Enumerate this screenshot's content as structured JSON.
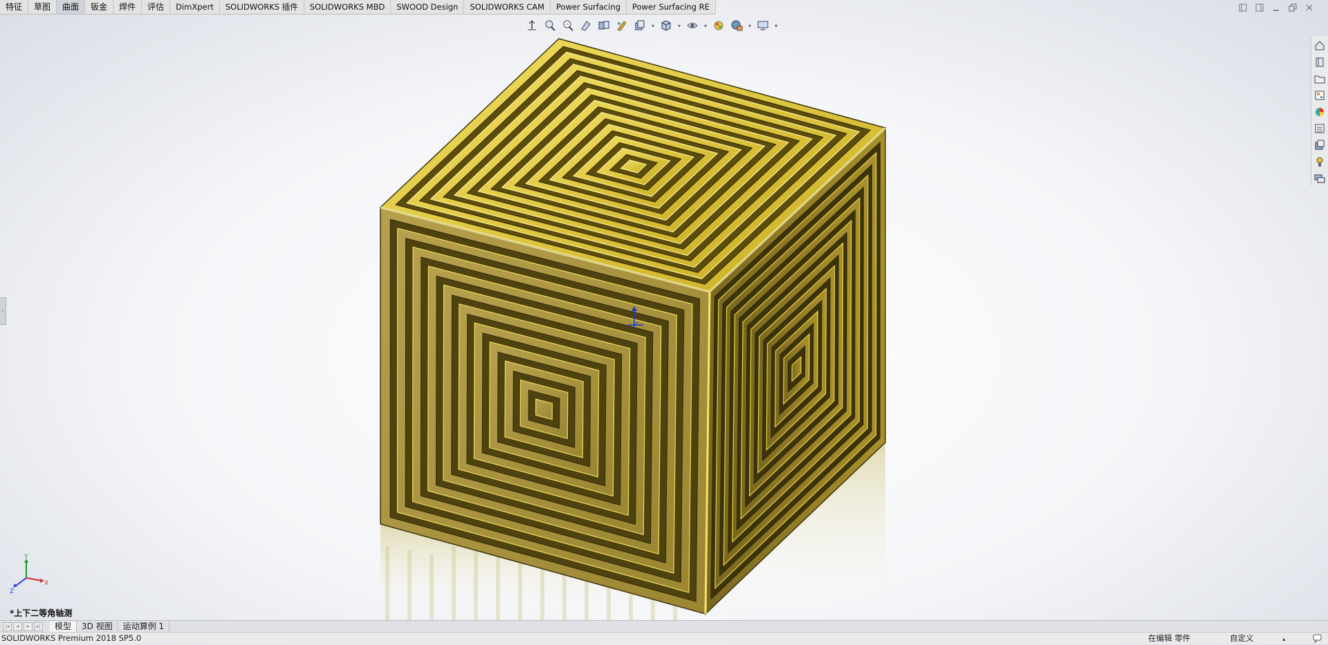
{
  "command_tabs": [
    {
      "label": "特征",
      "active": false
    },
    {
      "label": "草图",
      "active": false
    },
    {
      "label": "曲面",
      "active": true
    },
    {
      "label": "钣金",
      "active": false
    },
    {
      "label": "焊件",
      "active": false
    },
    {
      "label": "评估",
      "active": false
    },
    {
      "label": "DimXpert",
      "active": false
    },
    {
      "label": "SOLIDWORKS 插件",
      "active": false
    },
    {
      "label": "SOLIDWORKS MBD",
      "active": false
    },
    {
      "label": "SWOOD Design",
      "active": false
    },
    {
      "label": "SOLIDWORKS CAM",
      "active": false
    },
    {
      "label": "Power Surfacing",
      "active": false
    },
    {
      "label": "Power Surfacing RE",
      "active": false
    }
  ],
  "hud_toolbar": [
    "zoom-to-fit-icon",
    "zoom-area-icon",
    "previous-view-icon",
    "section-view-icon",
    "dynamic-annotation-icon",
    "view-orientation-icon",
    "display-style-icon",
    "hide-show-icon",
    "edit-appearance-icon",
    "apply-scene-icon",
    "view-settings-icon"
  ],
  "task_pane": [
    "solidworks-resources-icon",
    "design-library-icon",
    "file-explorer-icon",
    "view-palette-icon",
    "appearances-icon",
    "custom-properties-icon",
    "3dexperience-icon",
    "addin-icon",
    "forum-icon"
  ],
  "viewport": {
    "view_name": "*上下二等角轴测",
    "part_color": "#d8c23a"
  },
  "model_tabs": [
    {
      "label": "模型",
      "active": true
    },
    {
      "label": "3D 视图",
      "active": false
    },
    {
      "label": "运动算例 1",
      "active": false
    }
  ],
  "triad": {
    "x": "X",
    "y": "Y",
    "z": "Z"
  },
  "status": {
    "product": "SOLIDWORKS Premium 2018 SP5.0",
    "mode": "在编辑 零件",
    "units": "自定义"
  }
}
